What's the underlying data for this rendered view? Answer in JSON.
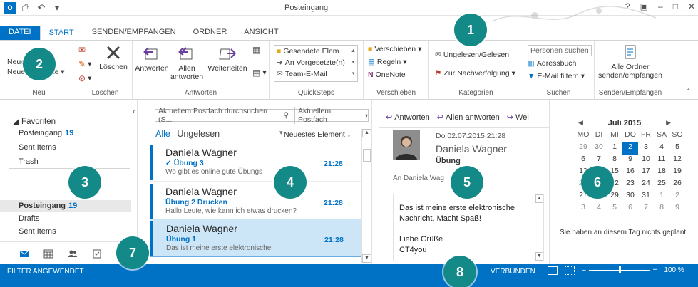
{
  "window": {
    "title": "Posteingang"
  },
  "tabs": [
    "DATEI",
    "START",
    "SENDEN/EMPFANGEN",
    "ORDNER",
    "ANSICHT"
  ],
  "ribbon": {
    "neu": {
      "label": "Neu",
      "btn_new_email": "Neue E-Mail",
      "btn_new_items": "Neue Elemente"
    },
    "loeschen": {
      "label": "Löschen",
      "btn_delete": "Löschen"
    },
    "antworten": {
      "label": "Antworten",
      "btn_reply": "Antworten",
      "btn_reply_all_1": "Allen",
      "btn_reply_all_2": "antworten",
      "btn_forward": "Weiterleiten"
    },
    "quicksteps": {
      "label": "QuickSteps",
      "items": [
        "Gesendete Elem...",
        "An Vorgesetzte(n)",
        "Team-E-Mail"
      ]
    },
    "verschieben": {
      "label": "Verschieben",
      "move": "Verschieben",
      "rules": "Regeln",
      "onenote": "OneNote"
    },
    "kategorien": {
      "label": "Kategorien",
      "unread_read": "Ungelesen/Gelesen",
      "followup": "Zur Nachverfolgung"
    },
    "suchen": {
      "label": "Suchen",
      "search_people_placeholder": "Personen suchen",
      "address_book": "Adressbuch",
      "filter_email": "E-Mail filtern"
    },
    "senden": {
      "label": "Senden/Empfangen",
      "btn_1": "Alle Ordner",
      "btn_2": "senden/empfangen"
    }
  },
  "folders": {
    "favorites_header": "Favoriten",
    "favorites": [
      {
        "name": "Posteingang",
        "count": "19"
      },
      {
        "name": "Sent Items",
        "count": ""
      },
      {
        "name": "Trash",
        "count": ""
      }
    ],
    "mailbox": [
      {
        "name": "Posteingang",
        "count": "19"
      },
      {
        "name": "Drafts",
        "count": ""
      },
      {
        "name": "Sent Items",
        "count": ""
      }
    ]
  },
  "messages": {
    "search_placeholder": "Aktuellem Postfach durchsuchen (S...",
    "search_scope": "Aktuellem Postfach",
    "filter_all": "Alle",
    "filter_unread": "Ungelesen",
    "sort": "Neuestes Element",
    "items": [
      {
        "from": "Daniela Wagner",
        "subject": "✓ Übung 3",
        "preview": "Wo gibt es online gute Übungs",
        "time": "21:28"
      },
      {
        "from": "Daniela Wagner",
        "subject": "Übung 2 Drucken",
        "preview": "Hallo Leute, wie kann ich etwas drucken?",
        "time": "21:28"
      },
      {
        "from": "Daniela Wagner",
        "subject": "Übung 1",
        "preview": "Das ist meine erste elektronische",
        "time": "21:28"
      }
    ]
  },
  "reading": {
    "reply": "Antworten",
    "reply_all": "Allen antworten",
    "forward": "Wei",
    "date": "Do 02.07.2015 21:28",
    "from": "Daniela Wagner",
    "subject": "Übung",
    "to": "An  Daniela Wag",
    "body_line1": "Das ist meine erste elektronische",
    "body_line2": "Nachricht. Macht Spaß!",
    "body_line3": "Liebe Grüße",
    "body_line4": "CT4you"
  },
  "calendar": {
    "month": "Juli 2015",
    "days": [
      "MO",
      "DI",
      "MI",
      "DO",
      "FR",
      "SA",
      "SO"
    ],
    "weeks": [
      [
        "29",
        "30",
        "1",
        "2",
        "3",
        "4",
        "5"
      ],
      [
        "6",
        "7",
        "8",
        "9",
        "10",
        "11",
        "12"
      ],
      [
        "13",
        "14",
        "15",
        "16",
        "17",
        "18",
        "19"
      ],
      [
        "20",
        "21",
        "22",
        "23",
        "24",
        "25",
        "26"
      ],
      [
        "27",
        "28",
        "29",
        "30",
        "31",
        "1",
        "2"
      ],
      [
        "3",
        "4",
        "5",
        "6",
        "7",
        "8",
        "9"
      ]
    ],
    "today": "2",
    "no_appointments": "Sie haben an diesem Tag nichts geplant."
  },
  "status": {
    "filter": "FILTER ANGEWENDET",
    "connection": "VERBUNDEN",
    "zoom": "100 %",
    "zoom_value": 0.5
  },
  "callouts": [
    "1",
    "2",
    "3",
    "4",
    "5",
    "6",
    "7",
    "8"
  ],
  "colors": {
    "accent": "#0072c6",
    "callout": "#138a88",
    "selected_row": "#cde6f7"
  }
}
